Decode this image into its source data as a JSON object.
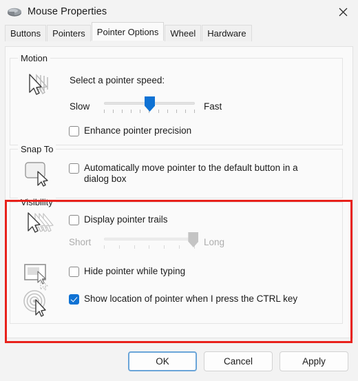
{
  "window": {
    "title": "Mouse Properties",
    "app_icon": "mouse-icon",
    "close_label": "✕"
  },
  "tabs": [
    {
      "label": "Buttons",
      "active": false
    },
    {
      "label": "Pointers",
      "active": false
    },
    {
      "label": "Pointer Options",
      "active": true
    },
    {
      "label": "Wheel",
      "active": false
    },
    {
      "label": "Hardware",
      "active": false
    }
  ],
  "groups": {
    "motion": {
      "legend": "Motion",
      "icon": "pointer-speed-icon",
      "speed_label": "Select a pointer speed:",
      "slider": {
        "min_label": "Slow",
        "max_label": "Fast",
        "value_percent": 50,
        "tick_count": 11,
        "enabled": true
      },
      "checkbox": {
        "label": "Enhance pointer precision",
        "checked": false
      }
    },
    "snap_to": {
      "legend": "Snap To",
      "icon": "default-button-cursor-icon",
      "checkbox": {
        "label": "Automatically move pointer to the default button in a dialog box",
        "checked": false
      }
    },
    "visibility": {
      "legend": "Visibility",
      "highlighted": true,
      "highlight_color": "#e8211b",
      "trails": {
        "icon": "pointer-trails-icon",
        "checkbox": {
          "label": "Display pointer trails",
          "checked": false
        },
        "slider": {
          "min_label": "Short",
          "max_label": "Long",
          "value_percent": 98,
          "tick_count": 7,
          "enabled": false
        }
      },
      "hide_typing": {
        "icon": "hide-pointer-typing-icon",
        "checkbox": {
          "label": "Hide pointer while typing",
          "checked": false
        }
      },
      "ctrl_locate": {
        "icon": "locate-pointer-icon",
        "checkbox": {
          "label": "Show location of pointer when I press the CTRL key",
          "checked": true
        }
      }
    }
  },
  "footer": {
    "ok": "OK",
    "cancel": "Cancel",
    "apply": "Apply"
  },
  "colors": {
    "accent": "#0f72d4",
    "highlight": "#e8211b",
    "window_bg": "#f3f3f3",
    "panel_bg": "#fafafa"
  }
}
